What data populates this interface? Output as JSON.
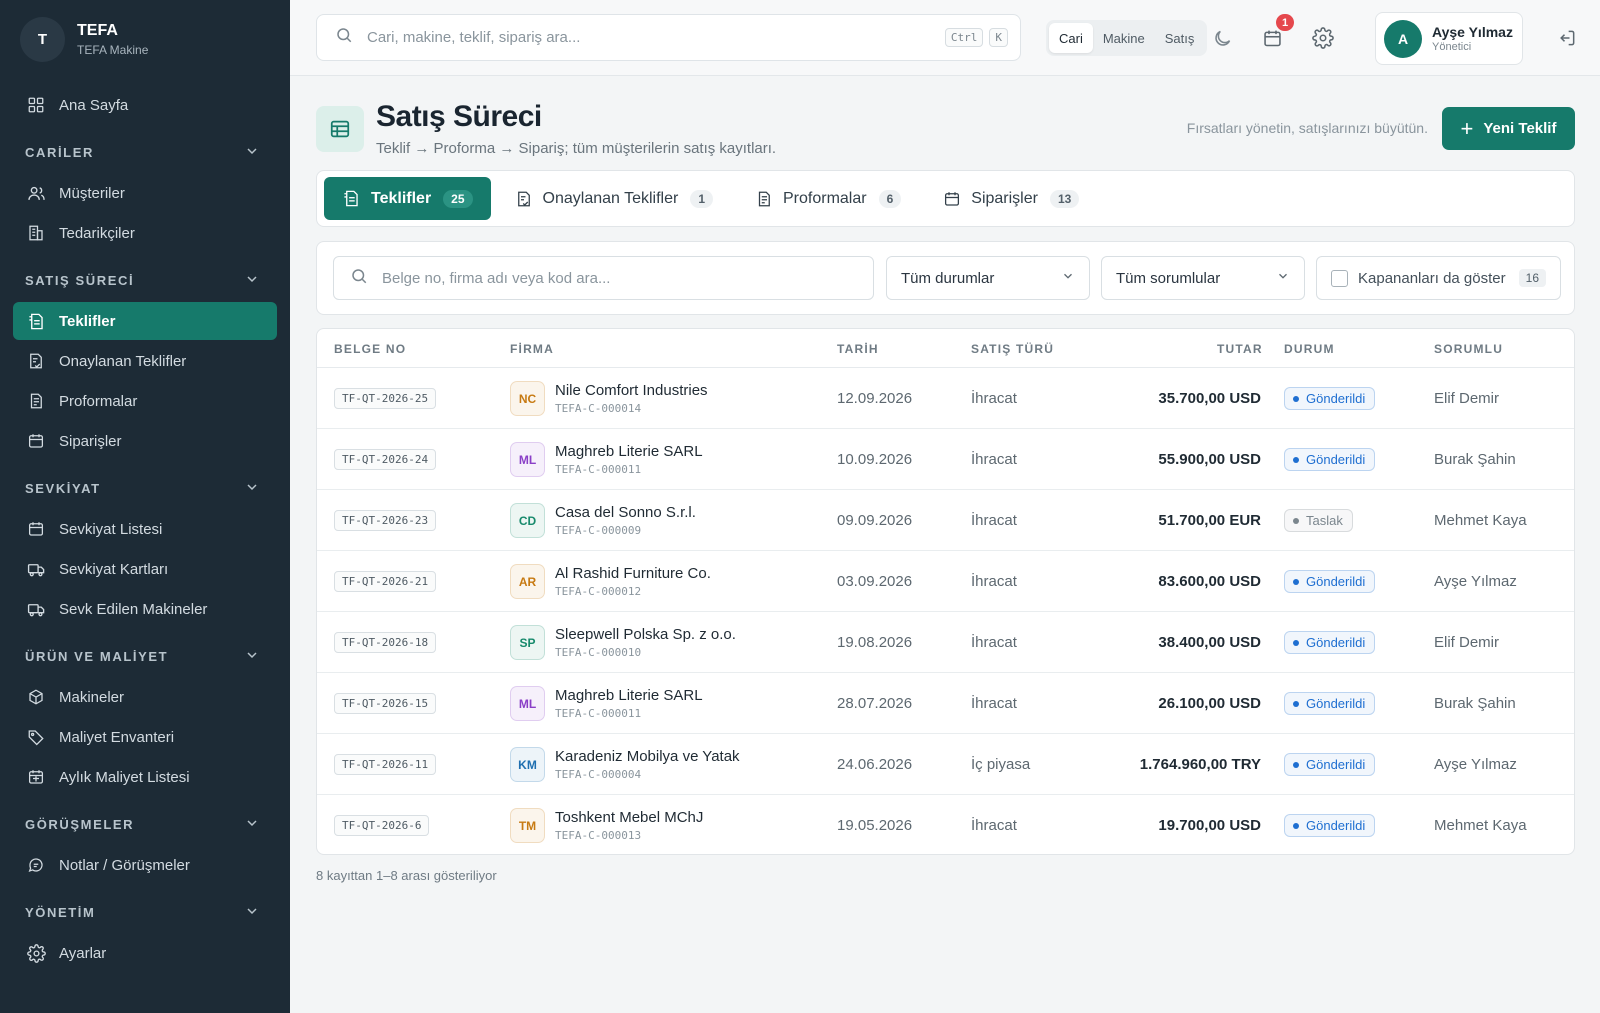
{
  "brand": {
    "initial": "T",
    "name": "TEFA",
    "sub": "TEFA Makine"
  },
  "sidebar": {
    "home": "Ana Sayfa",
    "sections": [
      {
        "title": "CARİLER",
        "items": [
          "Müşteriler",
          "Tedarikçiler"
        ]
      },
      {
        "title": "SATIŞ SÜRECİ",
        "items": [
          "Teklifler",
          "Onaylanan Teklifler",
          "Proformalar",
          "Siparişler"
        ]
      },
      {
        "title": "SEVKİYAT",
        "items": [
          "Sevkiyat Listesi",
          "Sevkiyat Kartları",
          "Sevk Edilen Makineler"
        ]
      },
      {
        "title": "ÜRÜN VE MALİYET",
        "items": [
          "Makineler",
          "Maliyet Envanteri",
          "Aylık Maliyet Listesi"
        ]
      },
      {
        "title": "GÖRÜŞMELER",
        "items": [
          "Notlar / Görüşmeler"
        ]
      },
      {
        "title": "YÖNETİM",
        "items": [
          "Ayarlar"
        ]
      }
    ],
    "active_item": "Teklifler"
  },
  "topbar": {
    "search_placeholder": "Cari, makine, teklif, sipariş ara...",
    "kbd_ctrl": "Ctrl",
    "kbd_k": "K",
    "scope": [
      "Cari",
      "Makine",
      "Satış"
    ],
    "scope_active": "Cari",
    "notification_count": "1",
    "user": {
      "initial": "A",
      "name": "Ayşe Yılmaz",
      "role": "Yönetici"
    }
  },
  "page": {
    "title": "Satış Süreci",
    "subtitle": "Teklif → Proforma → Sipariş; tüm müşterilerin satış kayıtları.",
    "tagline": "Fırsatları yönetin, satışlarınızı büyütün.",
    "new_button": "Yeni Teklif"
  },
  "tabs": [
    {
      "label": "Teklifler",
      "count": "25",
      "active": true
    },
    {
      "label": "Onaylanan Teklifler",
      "count": "1",
      "active": false
    },
    {
      "label": "Proformalar",
      "count": "6",
      "active": false
    },
    {
      "label": "Siparişler",
      "count": "13",
      "active": false
    }
  ],
  "filters": {
    "search_placeholder": "Belge no, firma adı veya kod ara...",
    "status_select": "Tüm durumlar",
    "owner_select": "Tüm sorumlular",
    "show_closed_label": "Kapananları da göster",
    "show_closed_count": "16"
  },
  "table": {
    "columns": [
      "BELGE NO",
      "FİRMA",
      "TARİH",
      "SATIŞ TÜRÜ",
      "TUTAR",
      "DURUM",
      "SORUMLU"
    ],
    "rows": [
      {
        "doc": "TF-QT-2026-25",
        "initials": "NC",
        "color": "#c77a12",
        "firm": "Nile Comfort Industries",
        "code": "TEFA-C-000014",
        "date": "12.09.2026",
        "type": "İhracat",
        "amount": "35.700,00 USD",
        "status": "Gönderildi",
        "owner": "Elif Demir"
      },
      {
        "doc": "TF-QT-2026-24",
        "initials": "ML",
        "color": "#8a3fc7",
        "firm": "Maghreb Literie SARL",
        "code": "TEFA-C-000011",
        "date": "10.09.2026",
        "type": "İhracat",
        "amount": "55.900,00 USD",
        "status": "Gönderildi",
        "owner": "Burak Şahin"
      },
      {
        "doc": "TF-QT-2026-23",
        "initials": "CD",
        "color": "#178a6c",
        "firm": "Casa del Sonno S.r.l.",
        "code": "TEFA-C-000009",
        "date": "09.09.2026",
        "type": "İhracat",
        "amount": "51.700,00 EUR",
        "status": "Taslak",
        "owner": "Mehmet Kaya"
      },
      {
        "doc": "TF-QT-2026-21",
        "initials": "AR",
        "color": "#c77a12",
        "firm": "Al Rashid Furniture Co.",
        "code": "TEFA-C-000012",
        "date": "03.09.2026",
        "type": "İhracat",
        "amount": "83.600,00 USD",
        "status": "Gönderildi",
        "owner": "Ayşe Yılmaz"
      },
      {
        "doc": "TF-QT-2026-18",
        "initials": "SP",
        "color": "#178a6c",
        "firm": "Sleepwell Polska Sp. z o.o.",
        "code": "TEFA-C-000010",
        "date": "19.08.2026",
        "type": "İhracat",
        "amount": "38.400,00 USD",
        "status": "Gönderildi",
        "owner": "Elif Demir"
      },
      {
        "doc": "TF-QT-2026-15",
        "initials": "ML",
        "color": "#8a3fc7",
        "firm": "Maghreb Literie SARL",
        "code": "TEFA-C-000011",
        "date": "28.07.2026",
        "type": "İhracat",
        "amount": "26.100,00 USD",
        "status": "Gönderildi",
        "owner": "Burak Şahin"
      },
      {
        "doc": "TF-QT-2026-11",
        "initials": "KM",
        "color": "#1f6fb0",
        "firm": "Karadeniz Mobilya ve Yatak",
        "code": "TEFA-C-000004",
        "date": "24.06.2026",
        "type": "İç piyasa",
        "amount": "1.764.960,00 TRY",
        "status": "Gönderildi",
        "owner": "Ayşe Yılmaz"
      },
      {
        "doc": "TF-QT-2026-6",
        "initials": "TM",
        "color": "#c77a12",
        "firm": "Toshkent Mebel MChJ",
        "code": "TEFA-C-000013",
        "date": "19.05.2026",
        "type": "İhracat",
        "amount": "19.700,00 USD",
        "status": "Gönderildi",
        "owner": "Mehmet Kaya"
      }
    ],
    "footer": "8 kayıttan 1–8 arası gösteriliyor"
  },
  "colors": {
    "accent": "#167a6b",
    "sidebar_bg": "#1d2b36",
    "status_sent": "#1f6fd1",
    "status_draft": "#7b868e"
  }
}
